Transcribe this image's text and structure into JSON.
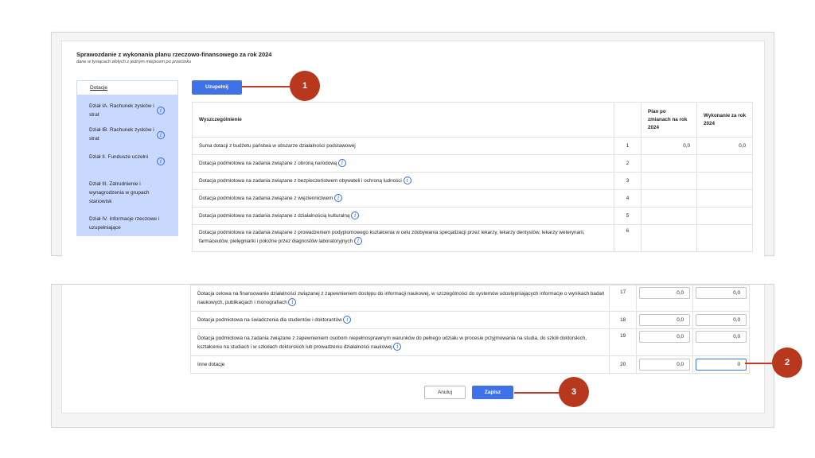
{
  "report": {
    "title": "Sprawozdanie z wykonania planu rzeczowo-finansowego za rok 2024",
    "subtitle": "dane w tysiącach złotych z jednym miejscem po przecinku"
  },
  "sidebar": {
    "items": [
      {
        "label": "Dotacje",
        "active": true,
        "info": false
      },
      {
        "label": "Dział IA. Rachunek zysków i strat",
        "info": true
      },
      {
        "label": "Dział IB. Rachunek zysków i strat",
        "info": true
      },
      {
        "label": "Dział II. Fundusze uczelni",
        "info": true
      },
      {
        "label": "Dział III. Zatrudnienie i wynagrodzenia w grupach stanowisk",
        "info": false
      },
      {
        "label": "Dział IV. Informacje rzeczowe i uzupełniające",
        "info": false
      }
    ]
  },
  "toolbar": {
    "fill_label": "Uzupełnij"
  },
  "table": {
    "headers": {
      "desc": "Wyszczególnienie",
      "plan": "Plan po zmianach na rok 2024",
      "done": "Wykonanie za rok 2024"
    },
    "top_rows": [
      {
        "desc": "Suma dotacji z budżetu państwa w obszarze działalności podstawowej",
        "no": "1",
        "plan": "0,0",
        "done": "0,0",
        "info": false
      },
      {
        "desc": "Dotacja podmiotowa na zadania związane z obroną narodową",
        "no": "2",
        "plan": "",
        "done": "",
        "info": true
      },
      {
        "desc": "Dotacja podmiotowa na zadania związane z bezpieczeństwem obywateli i ochroną ludności",
        "no": "3",
        "plan": "",
        "done": "",
        "info": true
      },
      {
        "desc": "Dotacja podmiotowa na zadania związane z więziennictwem",
        "no": "4",
        "plan": "",
        "done": "",
        "info": true
      },
      {
        "desc": "Dotacja podmiotowa na zadania związane z działalnością kulturalną",
        "no": "5",
        "plan": "",
        "done": "",
        "info": true
      },
      {
        "desc": "Dotacja podmiotowa na zadania związane z prowadzeniem podyplomowego kształcenia w celu zdobywania specjalizacji przez lekarzy, lekarzy dentystów, lekarzy weterynarii, farmaceutów, pielęgniarki i położne przez diagnostów laboratoryjnych",
        "no": "6",
        "plan": "",
        "done": "",
        "info": true
      }
    ],
    "bottom_rows": [
      {
        "desc": "Dotacja celowa na finansowanie działalności związanej z zapewnieniem dostępu do informacji naukowej, w szczególności do systemów udostępniających informacje o wynikach badań naukowych, publikacjach i monografiach",
        "no": "17",
        "plan": "0,0",
        "done": "0,0",
        "info": true
      },
      {
        "desc": "Dotacja podmiotowa na świadczenia dla studentów i doktorantów",
        "no": "18",
        "plan": "0,0",
        "done": "0,0",
        "info": true
      },
      {
        "desc": "Dotacja podmiotowa na zadania związane z zapewnieniem osobom niepełnosprawnym warunków do pełnego udziału w procesie przyjmowania na studia, do szkół doktorskich, kształceniu na studiach i w szkołach doktorskich lub prowadzeniu działalności naukowej",
        "no": "19",
        "plan": "0,0",
        "done": "0,0",
        "info": true
      },
      {
        "desc": "Inne dotacje",
        "no": "20",
        "plan": "0,0",
        "done": "0",
        "info": false
      }
    ]
  },
  "footer": {
    "cancel_label": "Anuluj",
    "save_label": "Zapisz"
  },
  "callouts": [
    "1",
    "2",
    "3"
  ],
  "colors": {
    "accent": "#3f72e6",
    "sidebar": "#c9d8ff",
    "callout": "#b8381d"
  }
}
